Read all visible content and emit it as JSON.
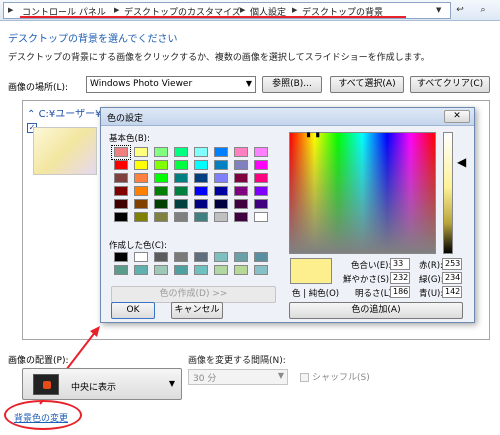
{
  "address_bar": {
    "crumbs": [
      "コントロール パネル",
      "デスクトップのカスタマイズ",
      "個人設定",
      "デスクトップの背景"
    ]
  },
  "heading": "デスクトップの背景を選んでください",
  "description": "デスクトップの背景にする画像をクリックするか、複数の画像を選択してスライドショーを作成します。",
  "location": {
    "label": "画像の場所(L):",
    "value": "Windows Photo Viewer",
    "browse": "参照(B)...",
    "select_all": "すべて選択(A)",
    "clear_all": "すべてクリア(C)"
  },
  "gallery": {
    "folder": "C:¥ユーザー¥"
  },
  "color_dialog": {
    "title": "色の設定",
    "basic_label": "基本色(B):",
    "custom_label": "作成した色(C):",
    "define_button": "色の作成(D) >>",
    "ok": "OK",
    "cancel": "キャンセル",
    "solid_label": "色 | 純色(O)",
    "add_button": "色の追加(A)",
    "hue_label": "色合い(E):",
    "hue": "33",
    "sat_label": "鮮やかさ(S):",
    "sat": "232",
    "lum_label": "明るさ(L):",
    "lum": "186",
    "red_label": "赤(R):",
    "red": "253",
    "green_label": "緑(G):",
    "green": "234",
    "blue_label": "青(U):",
    "blue": "142",
    "basic_colors": [
      [
        "#f08080",
        "#ffff80",
        "#80ff80",
        "#00ff80",
        "#80ffff",
        "#0080ff",
        "#ff80c0",
        "#ff80ff"
      ],
      [
        "#ff0000",
        "#ffff00",
        "#80ff00",
        "#00ff40",
        "#00ffff",
        "#0080c0",
        "#8080c0",
        "#ff00ff"
      ],
      [
        "#804040",
        "#ff8040",
        "#00ff00",
        "#008080",
        "#004080",
        "#8080ff",
        "#800040",
        "#ff0080"
      ],
      [
        "#800000",
        "#ff8000",
        "#008000",
        "#008040",
        "#0000ff",
        "#0000a0",
        "#800080",
        "#8000ff"
      ],
      [
        "#400000",
        "#804000",
        "#004000",
        "#004040",
        "#000080",
        "#000040",
        "#400040",
        "#400080"
      ],
      [
        "#000000",
        "#808000",
        "#808040",
        "#808080",
        "#408080",
        "#c0c0c0",
        "#400040",
        "#ffffff"
      ]
    ],
    "custom_colors": [
      [
        "#000000",
        "#ffffff",
        "#5c5c5c",
        "#7a7a7a",
        "#5f6d7d",
        "#7fbfbf",
        "#6ca0a8",
        "#5a8fa0"
      ],
      [
        "#5c9c8c",
        "#60b0b0",
        "#a0c8b8",
        "#50a0a0",
        "#70c0c0",
        "#b0d8a0",
        "#b8d898",
        "#88c0c8"
      ]
    ],
    "selected_color": "#fdee8e"
  },
  "placement": {
    "label": "画像の配置(P):",
    "value": "中央に表示"
  },
  "interval": {
    "label": "画像を変更する間隔(N):",
    "value": "30 分"
  },
  "shuffle": "シャッフル(S)",
  "bg_color_link": "背景色の変更",
  "colors": {
    "accent_red": "#e8222a",
    "link_blue": "#1e5eb5"
  }
}
